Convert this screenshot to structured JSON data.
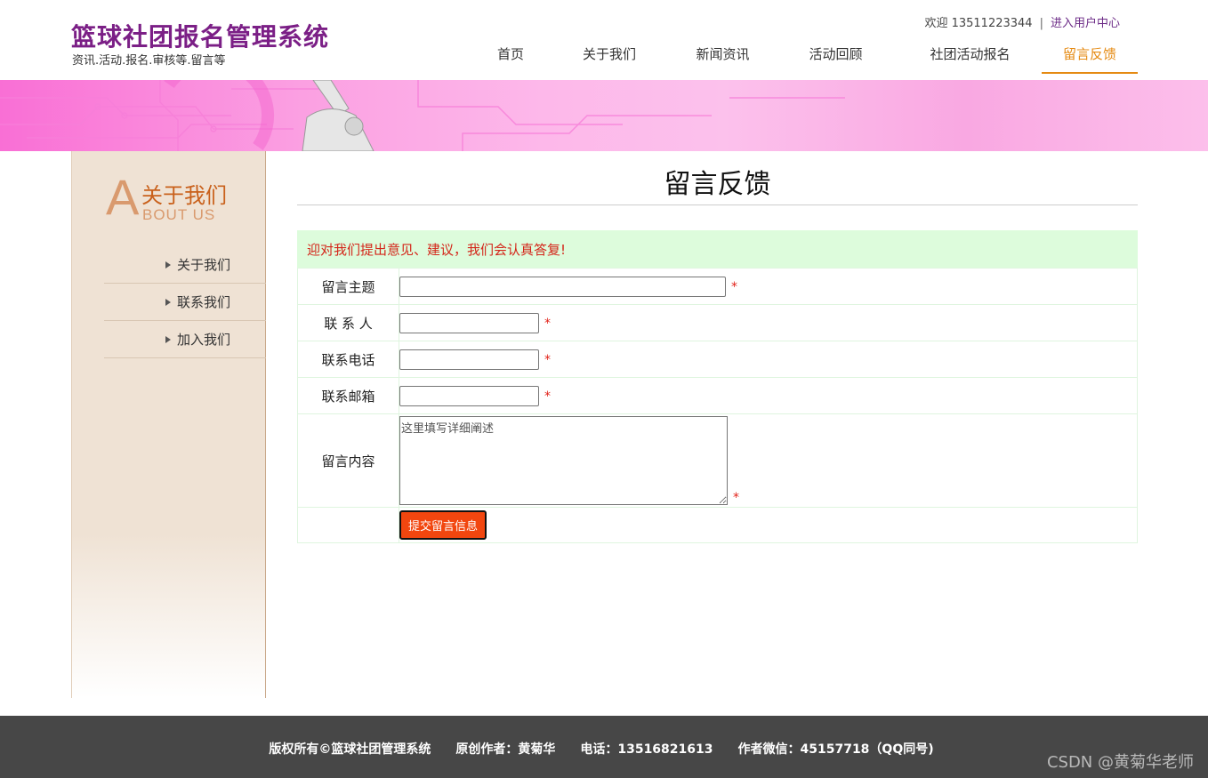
{
  "header": {
    "title": "篮球社团报名管理系统",
    "subtitle": "资讯.活动.报名.审核等.留言等",
    "welcome": "欢迎 13511223344",
    "separator": "|",
    "user_center": "进入用户中心"
  },
  "nav": {
    "items": [
      {
        "label": "首页"
      },
      {
        "label": "关于我们"
      },
      {
        "label": "新闻资讯"
      },
      {
        "label": "活动回顾"
      },
      {
        "label": "社团活动报名"
      },
      {
        "label": "留言反馈",
        "active": true
      }
    ]
  },
  "sidebar": {
    "big_letter": "A",
    "title": "关于我们",
    "subtitle": "BOUT US",
    "items": [
      {
        "label": "关于我们"
      },
      {
        "label": "联系我们"
      },
      {
        "label": "加入我们"
      }
    ]
  },
  "main": {
    "page_title": "留言反馈",
    "notice": "迎对我们提出意见、建议，我们会认真答复!",
    "form": {
      "subject_label": "留言主题",
      "subject_value": "",
      "contact_label": "联 系 人",
      "contact_value": "",
      "phone_label": "联系电话",
      "phone_value": "",
      "email_label": "联系邮箱",
      "email_value": "",
      "content_label": "留言内容",
      "content_value": "这里填写详细阐述",
      "required_mark": "*",
      "submit_label": "提交留言信息"
    }
  },
  "footer": {
    "text": "版权所有©篮球社团管理系统　　原创作者：黄菊华　　电话：13516821613　　作者微信：45157718（QQ同号)",
    "watermark": "CSDN @黄菊华老师"
  },
  "colors": {
    "brand_purple": "#7b1f86",
    "nav_active": "#e58a12",
    "banner_pink": "#f96fd5",
    "notice_bg": "#ddfcdc",
    "notice_text": "#d4261a",
    "submit_bg": "#f2460f",
    "footer_bg": "#474747"
  },
  "icons": {
    "side_menu_arrow": "chevron-right-icon"
  }
}
